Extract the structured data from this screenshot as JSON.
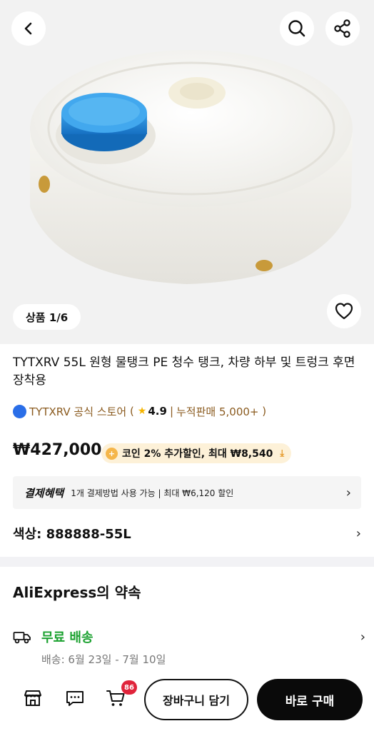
{
  "gallery": {
    "counter": "상품 1/6"
  },
  "product": {
    "title": "TYTXRV 55L 원형 물탱크 PE 청수 탱크, 차량 하부 및 트렁크 후면 장착용",
    "store_name": "TYTXRV 공식 스토어",
    "rating": "4.9",
    "sales": "누적판매 5,000+",
    "price": "₩427,000",
    "coin_offer": "코인 2% 추가할인, 최대 ₩8,540"
  },
  "benefit": {
    "title": "결제혜택",
    "text": "1개 결제방법 사용 가능 | 최대 ₩6,120 할인"
  },
  "option": {
    "color_label": "색상: 888888-55L"
  },
  "promise": {
    "title": "AliExpress의 약속",
    "shipping_label": "무료 배송",
    "shipping_date": "배송: 6월 23일 - 7월 10일"
  },
  "bottom_bar": {
    "cart_count": "86",
    "add_to_cart": "장바구니 담기",
    "buy_now": "바로 구매"
  },
  "icons": {
    "back": "chevron-left-icon",
    "search": "search-icon",
    "share": "share-icon",
    "wishlist": "heart-icon",
    "store": "store-icon",
    "chat": "chat-icon",
    "cart": "cart-icon",
    "truck": "truck-icon"
  },
  "colors": {
    "accent_free_shipping": "#1aa12f",
    "badge": "#e0243b",
    "store_text": "#8a5a1e",
    "coin_chip_bg": "#fdf1d8"
  }
}
